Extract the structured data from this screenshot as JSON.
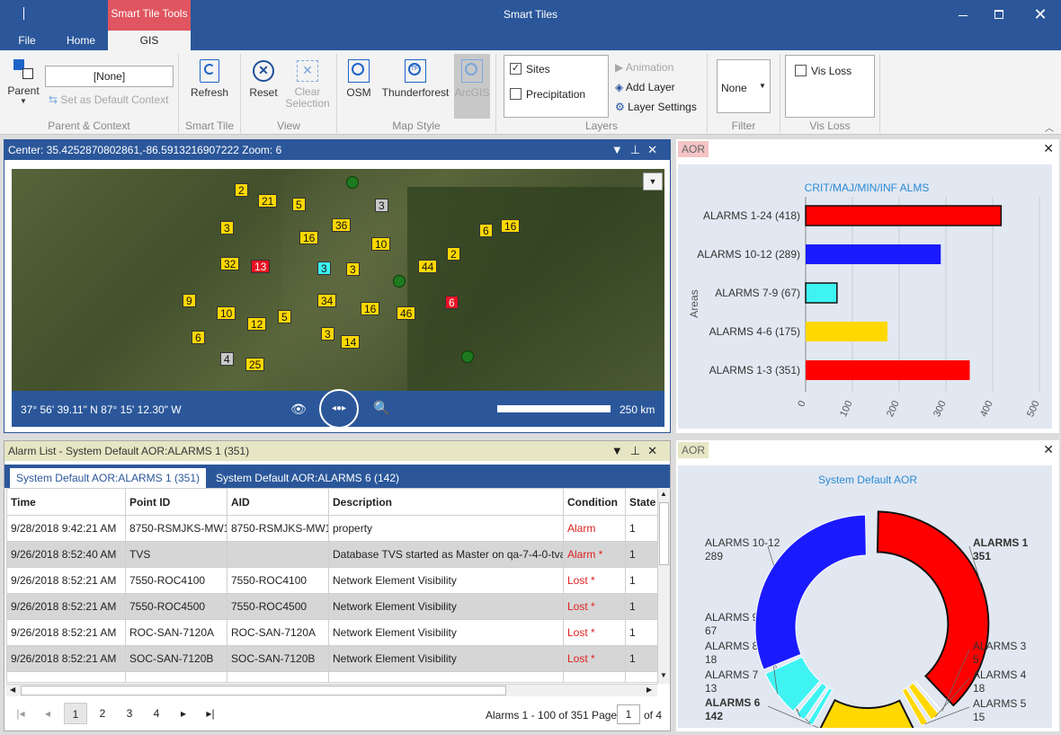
{
  "app": {
    "title": "Smart Tiles",
    "context_tab": "Smart Tile Tools",
    "window_controls": [
      "minimize-icon",
      "maximize-icon",
      "close-icon"
    ]
  },
  "tabs": {
    "file": "File",
    "home": "Home",
    "gis": "GIS"
  },
  "ribbon": {
    "parent": {
      "label": "Parent",
      "combo_value": "[None]",
      "default_ctx": "Set as Default Context",
      "group": "Parent & Context"
    },
    "smart_tile": {
      "refresh": "Refresh",
      "group": "Smart Tile"
    },
    "view": {
      "reset": "Reset",
      "clear": "Clear Selection",
      "group": "View"
    },
    "map_style": {
      "osm": "OSM",
      "thunderforest": "Thunderforest",
      "arcgis": "ArcGIS",
      "group": "Map Style"
    },
    "layers": {
      "sites": "Sites",
      "precip": "Precipitation",
      "animation": "Animation",
      "add_layer": "Add Layer",
      "layer_settings": "Layer Settings",
      "group": "Layers",
      "sites_checked": true,
      "precip_checked": false
    },
    "filter": {
      "value": "None",
      "group": "Filter"
    },
    "visloss": {
      "label": "Vis Loss",
      "group": "Vis Loss",
      "checked": false
    }
  },
  "map": {
    "header": "Center:  35.4252870802861,-86.5913216907222  Zoom: 6",
    "coords": "37° 56' 39.11\" N 87° 15' 12.30\" W",
    "scale": "250 km",
    "markers": [
      {
        "t": "2",
        "c": "y"
      },
      {
        "t": "21",
        "c": "y"
      },
      {
        "t": "5",
        "c": "y"
      },
      {
        "t": "3",
        "c": "g"
      },
      {
        "t": "3",
        "c": "y"
      },
      {
        "t": "36",
        "c": "y"
      },
      {
        "t": "16",
        "c": "y"
      },
      {
        "t": "16",
        "c": "y"
      },
      {
        "t": "10",
        "c": "y"
      },
      {
        "t": "6",
        "c": "y"
      },
      {
        "t": "2",
        "c": "y"
      },
      {
        "t": "32",
        "c": "y"
      },
      {
        "t": "13",
        "c": "r"
      },
      {
        "t": "3",
        "c": "c"
      },
      {
        "t": "3",
        "c": "y"
      },
      {
        "t": "44",
        "c": "y"
      },
      {
        "t": "9",
        "c": "y"
      },
      {
        "t": "34",
        "c": "y"
      },
      {
        "t": "16",
        "c": "y"
      },
      {
        "t": "46",
        "c": "y"
      },
      {
        "t": "6",
        "c": "r"
      },
      {
        "t": "10",
        "c": "y"
      },
      {
        "t": "12",
        "c": "y"
      },
      {
        "t": "5",
        "c": "y"
      },
      {
        "t": "6",
        "c": "y"
      },
      {
        "t": "3",
        "c": "y"
      },
      {
        "t": "14",
        "c": "y"
      },
      {
        "t": "4",
        "c": "g"
      },
      {
        "t": "25",
        "c": "y"
      }
    ]
  },
  "aor_bar": {
    "tag": "AOR"
  },
  "aor_donut": {
    "tag": "AOR"
  },
  "chart_data": [
    {
      "type": "bar",
      "orientation": "horizontal",
      "title": "CRIT/MAJ/MIN/INF ALMS",
      "ylabel": "Areas",
      "categories": [
        "ALARMS 1-24 (418)",
        "ALARMS 10-12 (289)",
        "ALARMS 7-9 (67)",
        "ALARMS 4-6 (175)",
        "ALARMS 1-3 (351)"
      ],
      "values": [
        418,
        289,
        67,
        175,
        351
      ],
      "colors": [
        "#ff0000",
        "#1a1aff",
        "#3ff3f3",
        "#ffd800",
        "#ff0000"
      ],
      "xlim": [
        0,
        500
      ],
      "ticks": [
        "0",
        "100",
        "200",
        "300",
        "400",
        "500"
      ],
      "grid": true
    },
    {
      "type": "pie",
      "donut": true,
      "title": "System Default AOR",
      "slices": [
        {
          "name": "ALARMS 1",
          "value": 351,
          "color": "#ff0000",
          "bold": true
        },
        {
          "name": "ALARMS 3",
          "value": 5,
          "color": "#ff0000"
        },
        {
          "name": "ALARMS 4",
          "value": 18,
          "color": "#ffd800"
        },
        {
          "name": "ALARMS 5",
          "value": 15,
          "color": "#ffd800"
        },
        {
          "name": "ALARMS 6",
          "value": 142,
          "color": "#ffd800",
          "bold": true
        },
        {
          "name": "ALARMS 7",
          "value": 13,
          "color": "#3ff3f3"
        },
        {
          "name": "ALARMS 8",
          "value": 18,
          "color": "#3ff3f3"
        },
        {
          "name": "ALARMS 9",
          "value": 67,
          "color": "#3ff3f3"
        },
        {
          "name": "ALARMS 10-12",
          "value": 289,
          "color": "#1a1aff"
        }
      ]
    }
  ],
  "alarm_list": {
    "header": "Alarm List - System Default AOR:ALARMS 1 (351)",
    "tabs": [
      "System Default AOR:ALARMS 1 (351)",
      "System Default AOR:ALARMS 6 (142)"
    ],
    "columns": [
      "Time",
      "Point ID",
      "AID",
      "Description",
      "Condition",
      "State"
    ],
    "rows": [
      [
        "9/28/2018 9:42:21 AM",
        "8750-RSMJKS-MW1",
        "8750-RSMJKS-MW1",
        "property",
        "Alarm",
        "1"
      ],
      [
        "9/26/2018 8:52:40 AM",
        "TVS",
        "",
        "Database TVS started as Master on qa-7-4-0-tva",
        "Alarm  *",
        "1"
      ],
      [
        "9/26/2018 8:52:21 AM",
        "7550-ROC4100",
        "7550-ROC4100",
        "Network Element Visibility",
        "Lost   *",
        "1"
      ],
      [
        "9/26/2018 8:52:21 AM",
        "7550-ROC4500",
        "7550-ROC4500",
        "Network Element Visibility",
        "Lost   *",
        "1"
      ],
      [
        "9/26/2018 8:52:21 AM",
        "ROC-SAN-7120A",
        "ROC-SAN-7120A",
        "Network Element Visibility",
        "Lost   *",
        "1"
      ],
      [
        "9/26/2018 8:52:21 AM",
        "SOC-SAN-7120B",
        "SOC-SAN-7120B",
        "Network Element Visibility",
        "Lost   *",
        "1"
      ]
    ],
    "pages": [
      "1",
      "2",
      "3",
      "4"
    ],
    "status": "Alarms 1 - 100 of 351 Page",
    "page_value": "1",
    "of": "of 4"
  }
}
